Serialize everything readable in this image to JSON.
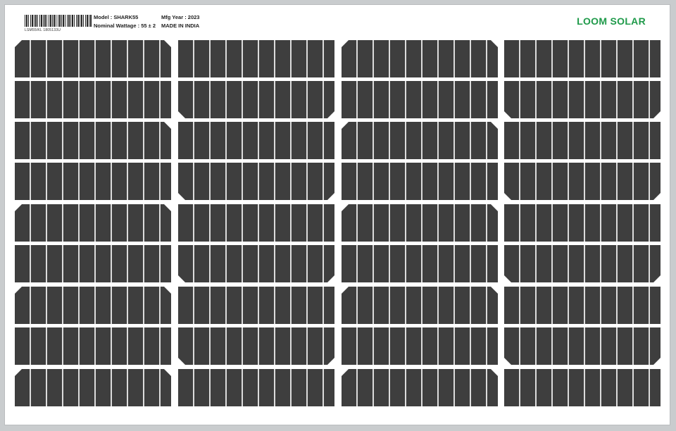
{
  "label": {
    "barcode_text": "LSM55/KL 1805133U",
    "model": "Model : SHARK55",
    "nominal_wattage": "Nominal Wattage : 55 ± 2",
    "mfg_year": "Mfg Year : 2023",
    "made_in": "MADE IN INDIA"
  },
  "brand": {
    "name": "LOOM SOLAR",
    "color": "#1f9a4a"
  },
  "cells": {
    "rows": 9,
    "columns": 4,
    "color": "#3e3e3e",
    "busbar_color": "#dcdcdc"
  }
}
